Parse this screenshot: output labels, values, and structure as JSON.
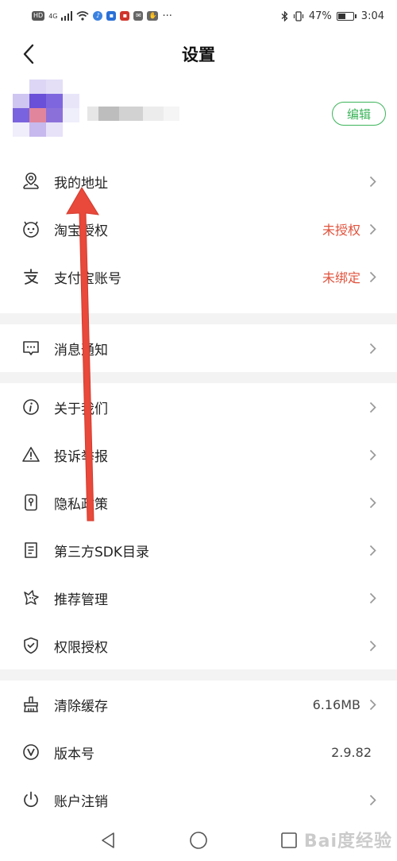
{
  "status_bar": {
    "hd": "HD",
    "net": "4G",
    "battery_pct": "47%",
    "battery_level": 0.47,
    "time": "3:04",
    "more": "···"
  },
  "header": {
    "title": "设置"
  },
  "profile": {
    "edit_label": "编辑"
  },
  "sections": [
    [
      {
        "label": "我的地址",
        "value": "",
        "icon": "location-person-icon"
      },
      {
        "label": "淘宝授权",
        "value": "未授权",
        "icon": "taobao-icon"
      },
      {
        "label": "支付宝账号",
        "value": "未绑定",
        "icon": "alipay-icon"
      }
    ],
    [
      {
        "label": "消息通知",
        "value": "",
        "icon": "message-icon"
      }
    ],
    [
      {
        "label": "关于我们",
        "value": "",
        "icon": "info-icon"
      },
      {
        "label": "投诉举报",
        "value": "",
        "icon": "warning-icon"
      },
      {
        "label": "隐私政策",
        "value": "",
        "icon": "privacy-lock-icon"
      },
      {
        "label": "第三方SDK目录",
        "value": "",
        "icon": "document-icon"
      },
      {
        "label": "推荐管理",
        "value": "",
        "icon": "recommend-icon"
      },
      {
        "label": "权限授权",
        "value": "",
        "icon": "shield-check-icon"
      }
    ],
    [
      {
        "label": "清除缓存",
        "value": "6.16MB",
        "icon": "broom-icon"
      },
      {
        "label": "版本号",
        "value": "2.9.82",
        "icon": "version-icon"
      },
      {
        "label": "账户注销",
        "value": "",
        "icon": "power-icon"
      }
    ]
  ],
  "colors": {
    "accent_green": "#3cb45a",
    "warning_red": "#e0533d",
    "annotation_arrow": "#e8493a",
    "divider_gray": "#f3f3f3"
  },
  "watermark": "Bai度经验"
}
